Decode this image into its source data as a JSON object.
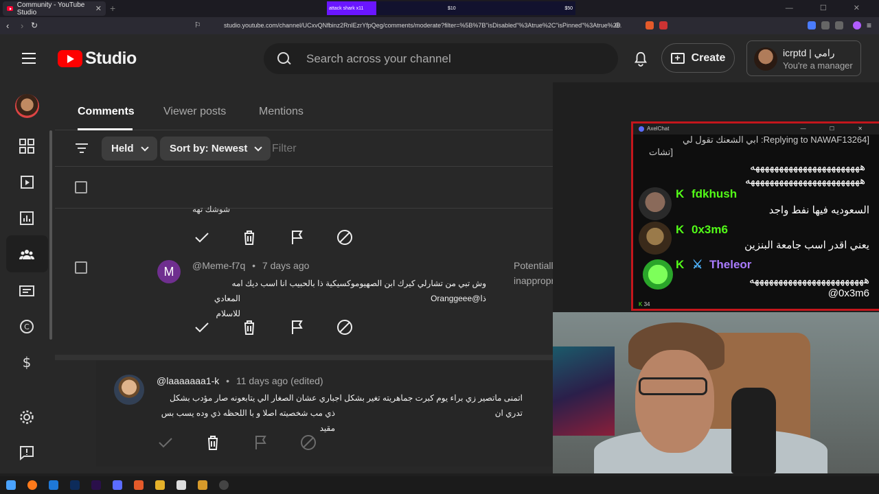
{
  "browser": {
    "tab_title": "Community - YouTube Studio",
    "tab_close": "✕",
    "new_tab": "+",
    "url": "studio.youtube.com/channel/UCxvQNfbinz2RnlEzrYfpQeg/comments/moderate?filter=%5B%7B\"isDisabled\"%3Atrue%2C\"isPinned\"%3Atrue%2...",
    "donation": {
      "label": "attack shark x11",
      "mid": "$10",
      "end": "$50",
      "progress": 0.2
    }
  },
  "header": {
    "studio_label": "Studio",
    "search_placeholder": "Search across your channel",
    "create_label": "Create",
    "account_name": "icrptd | رامي",
    "account_role": "You're a manager"
  },
  "tabs": [
    {
      "label": "Comments"
    },
    {
      "label": "Viewer posts"
    },
    {
      "label": "Mentions"
    }
  ],
  "filters": {
    "held": "Held",
    "sort": "Sort by: Newest",
    "filter_placeholder": "Filter"
  },
  "comments": [
    {
      "partial_text": "شوشك تهه"
    },
    {
      "avatar_letter": "M",
      "handle": "@Meme-f7q",
      "time": "7 days ago",
      "text_line1": "وش تبي من تشارلي كيرك ابن الصهيوموكسيكية ذا بالحبيب انا اسب ديك امه ذا@Oranggeee",
      "text_line2": "المعادي للاسلام",
      "status": "Potentially inappropriate"
    }
  ],
  "reply": {
    "handle": "@laaaaaaa1-k",
    "time": "11 days ago (edited)",
    "text_line1": "اتمنى ماتصير زي براء يوم كبرت جماهريته تغير بشكل اجباري عشان الصغار الي يتابعونه صار مؤدب بشكل تدري ان",
    "text_line2": "ذي مب شخصيته اصلا و با اللحظه ذي وده يسب بس مقيد"
  },
  "chat": {
    "app_title": "AxelChat",
    "window_controls": "— ☐ ✕",
    "top_line1": "[Replying to NAWAF13264: ابي الشعنك تقول لي",
    "top_line2": "[تشات",
    "top_line3": "هههههههههههههههههههههههه",
    "top_line4": "ههههههههههههههههههههههههه",
    "messages": [
      {
        "user": "fdkhush",
        "color": "#53fc18",
        "text": "السعوديه فيها نفط واجد"
      },
      {
        "user": "0x3m6",
        "color": "#53fc18",
        "text": "يعني اقدر اسب جامعة البنزين"
      },
      {
        "user": "Theleor",
        "color": "#a97bff",
        "text": "ههههههههههههههههههههههههه",
        "text2": "@0x3m6"
      }
    ],
    "viewer_count": "34"
  }
}
